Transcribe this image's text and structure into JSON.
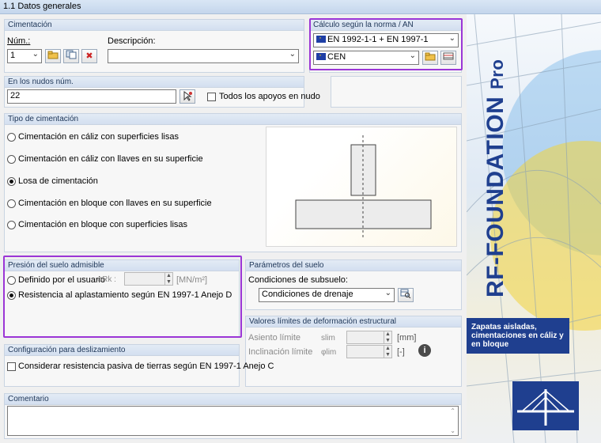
{
  "title": "1.1 Datos generales",
  "cimentacion": {
    "title": "Cimentación",
    "num_label": "Núm.:",
    "num_value": "1",
    "desc_label": "Descripción:",
    "desc_value": ""
  },
  "norma": {
    "title": "Cálculo según la norma / AN",
    "standard": "EN 1992-1-1 + EN 1997-1",
    "annex": "CEN"
  },
  "nudos": {
    "title": "En los nudos núm.",
    "value": "22",
    "all_supports_label": "Todos los apoyos en nudo"
  },
  "tipo": {
    "title": "Tipo de cimentación",
    "options": [
      "Cimentación en cáliz con superficies lisas",
      "Cimentación en cáliz con llaves en su superficie",
      "Losa de cimentación",
      "Cimentación en bloque con llaves en su superficie",
      "Cimentación en bloque con superficies lisas"
    ]
  },
  "presion": {
    "title": "Presión del suelo admisible",
    "opt_user": "Definido por el usuario",
    "sigma_label": "σRk :",
    "sigma_value": "",
    "unit": "[MN/m²]",
    "opt_annex": "Resistencia al aplastamiento según EN 1997-1 Anejo D"
  },
  "parametros": {
    "title": "Parámetros del suelo",
    "cond_label": "Condiciones de subsuelo:",
    "cond_value": "Condiciones de drenaje"
  },
  "limites": {
    "title": "Valores límites de deformación estructural",
    "asiento_label": "Asiento límite",
    "asiento_sym": "slim",
    "asiento_unit": "[mm]",
    "incl_label": "Inclinación límite",
    "incl_sym": "φlim",
    "incl_unit": "[-]"
  },
  "deslizamiento": {
    "title": "Configuración para deslizamiento",
    "check_label": "Considerar resistencia pasiva de tierras según EN 1997-1 Anejo C"
  },
  "comentario": {
    "title": "Comentario",
    "value": ""
  },
  "brand": {
    "name": "RF-FOUNDATION",
    "suffix": "Pro",
    "subtitle": "Zapatas aisladas, cimentaciones en cáliz y en bloque",
    "color": "#1f3f8f"
  },
  "colors": {
    "highlight": "#9b36d6",
    "group_head": "#d3dff0"
  }
}
